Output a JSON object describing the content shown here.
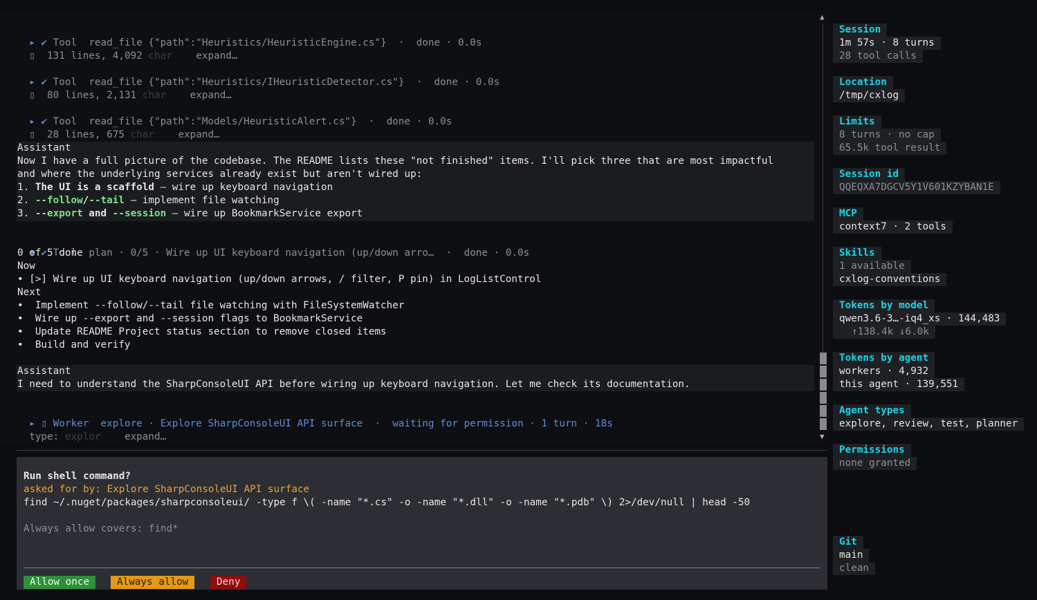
{
  "transcript": {
    "tool1": {
      "marker": "▸ ✔",
      "kind": "Tool",
      "name": "read_file",
      "args": "{\"path\":\"Heuristics/HeuristicEngine.cs\"}",
      "status": "·  done · 0.0s",
      "icon": "▯",
      "summary": "131 lines, 4,092",
      "faded": "char",
      "expand": "expand…"
    },
    "tool2": {
      "marker": "▸ ✔",
      "kind": "Tool",
      "name": "read_file",
      "args": "{\"path\":\"Heuristics/IHeuristicDetector.cs\"}",
      "status": "·  done · 0.0s",
      "icon": "▯",
      "summary": "80 lines, 2,131",
      "faded": "char",
      "expand": "expand…"
    },
    "tool3": {
      "marker": "▸ ✔",
      "kind": "Tool",
      "name": "read_file",
      "args": "{\"path\":\"Models/HeuristicAlert.cs\"}",
      "status": "·  done · 0.0s",
      "icon": "▯",
      "summary": "28 lines, 675",
      "faded": "char",
      "expand": "expand…"
    },
    "assistant1": {
      "label": "Assistant",
      "line1": "Now I have a full picture of the codebase. The README lists these \"not finished\" items. I'll pick three that are most impactful",
      "line2": "and where the underlying services already exist but aren't wired up:",
      "item1_num": "1.",
      "item1_bold": "The UI is a scaffold",
      "item1_rest": " — wire up keyboard navigation",
      "item2_num": "2.",
      "item2_a": "--follow",
      "item2_b": "/",
      "item2_c": "--tail",
      "item2_rest": " — implement file watching",
      "item3_num": "3.",
      "item3_a": "--export",
      "item3_b": " and ",
      "item3_c": "--session",
      "item3_rest": " — wire up BookmarkService export"
    },
    "plan": {
      "marker": "▾ ✔",
      "kind": "Tool",
      "header": "plan · 0/5 · Wire up UI keyboard navigation (up/down arro…  ·  done · 0.0s",
      "progress": "0 of 5 done",
      "now_label": "Now",
      "now_item": "• [>] Wire up UI keyboard navigation (up/down arrows, / filter, P pin) in LogListControl",
      "next_label": "Next",
      "next_items": [
        "•  Implement --follow/--tail file watching with FileSystemWatcher",
        "•  Wire up --export and --session flags to BookmarkService",
        "•  Update README Project status section to remove closed items",
        "•  Build and verify"
      ]
    },
    "assistant2": {
      "label": "Assistant",
      "line1": "I need to understand the SharpConsoleUI API before wiring up keyboard navigation. Let me check its documentation."
    },
    "worker": {
      "marker": "▸",
      "icon": "▯",
      "kind": "Worker",
      "name": "explore",
      "desc": "· Explore SharpConsoleUI API surface",
      "status": "·  waiting for permission · 1 turn · 18s",
      "type_label": "type:",
      "faded": "explor",
      "expand": "expand…"
    }
  },
  "permission": {
    "title": "Run shell command?",
    "asked_by": "asked for by: Explore SharpConsoleUI API surface",
    "command": "find ~/.nuget/packages/sharpconsoleui/ -type f \\( -name \"*.cs\" -o -name \"*.dll\" -o -name \"*.pdb\" \\) 2>/dev/null | head -50",
    "covers": "Always allow covers: find*",
    "buttons": {
      "allow_once": "Allow once",
      "always_allow": "Always allow",
      "deny": "Deny"
    },
    "colors": {
      "allow": "#2f8f3a",
      "always": "#e39a15",
      "deny": "#8e0d0d"
    }
  },
  "sidebar": {
    "session": {
      "title": "Session",
      "line1": "1m 57s · 8 turns",
      "line2": "28 tool calls"
    },
    "location": {
      "title": "Location",
      "value": "/tmp/cxlog"
    },
    "limits": {
      "title": "Limits",
      "line1": "8 turns · no cap",
      "line2": "65.5k tool result"
    },
    "session_id": {
      "title": "Session id",
      "value": "QQEQXA7DGCV5Y1V601KZYBAN1E"
    },
    "mcp": {
      "title": "MCP",
      "value": "context7 · 2 tools"
    },
    "skills": {
      "title": "Skills",
      "line1": "1 available",
      "line2": "cxlog-conventions"
    },
    "tokens_model": {
      "title": "Tokens by model",
      "line1": "qwen3.6-3…-iq4_xs · 144,483",
      "line2": "↑138.4k ↓6.0k"
    },
    "tokens_agent": {
      "title": "Tokens by agent",
      "line1": "workers · 4,932",
      "line2": "this agent · 139,551"
    },
    "agent_types": {
      "title": "Agent types",
      "value": "explore, review, test, planner"
    },
    "permissions": {
      "title": "Permissions",
      "value": "none granted"
    },
    "git": {
      "title": "Git",
      "line1": "main",
      "line2": "clean"
    }
  },
  "scroll": {
    "up": "▲",
    "down": "▼",
    "position_fraction": 0.85
  },
  "accent": "#1fd3e6"
}
